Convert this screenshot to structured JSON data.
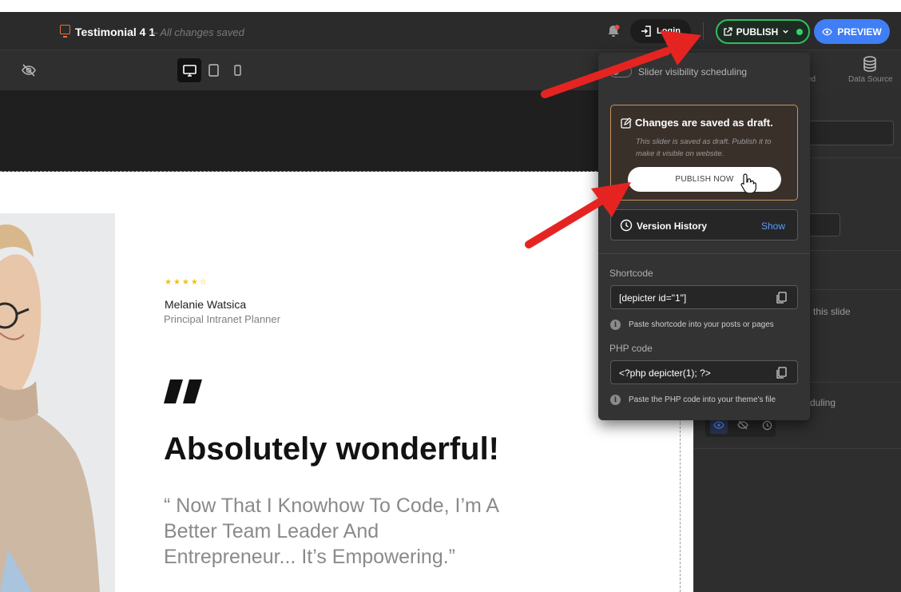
{
  "header": {
    "title": "Testimonial 4 1",
    "status": "– All changes saved",
    "login_label": "Login",
    "publish_label": "PUBLISH",
    "preview_label": "PREVIEW"
  },
  "toolbar": {
    "tab_fragment": "ed",
    "data_source_label": "Data Source"
  },
  "canvas": {
    "rating_stars": "★★★★☆",
    "rating_value": 4,
    "person_name": "Melanie Watsica",
    "person_role": "Principal Intranet Planner",
    "headline": "Absolutely wonderful!",
    "quote": "“ Now That I Knowhow To Code, I’m A Better Team Leader And Entrepreneur... It’s Empowering.”"
  },
  "popup": {
    "schedule_label": "Slider visibility scheduling",
    "draft_title": "Changes are saved as draft.",
    "draft_description": "This slider is saved as draft. Publish it to make it visible on website.",
    "publish_now_label": "PUBLISH NOW",
    "version_history_label": "Version History",
    "version_show_label": "Show",
    "shortcode_label": "Shortcode",
    "shortcode_value": "[depicter id=\"1\"]",
    "shortcode_hint": "Paste shortcode into your posts or pages",
    "php_label": "PHP code",
    "php_value": "<?php depicter(1); ?>",
    "php_hint": "Paste the PHP code into your theme's file"
  },
  "sidebar": {
    "slide_text_fragment": "this slide",
    "scheduling_text_fragment": "duling"
  },
  "colors": {
    "publish_accent": "#2fbf5e",
    "preview_accent": "#3f7ef5",
    "draft_border": "#c8935a",
    "annotation_red": "#e52421",
    "link_blue": "#5b9bff"
  }
}
